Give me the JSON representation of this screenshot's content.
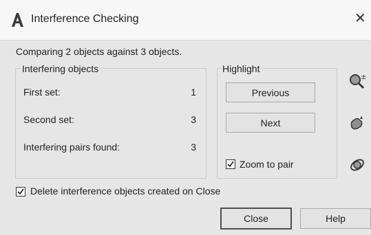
{
  "window": {
    "title": "Interference Checking",
    "close_symbol": "✕"
  },
  "summary": "Comparing 2 objects against 3 objects.",
  "interfering_objects": {
    "group_title": "Interfering objects",
    "rows": [
      {
        "label": "First set:",
        "value": "1"
      },
      {
        "label": "Second set:",
        "value": "3"
      },
      {
        "label": "Interfering pairs found:",
        "value": "3"
      }
    ]
  },
  "highlight": {
    "group_title": "Highlight",
    "previous_label": "Previous",
    "next_label": "Next",
    "zoom_to_pair_label": "Zoom to pair",
    "zoom_to_pair_checked": true
  },
  "side_icons": [
    "zoom-realtime-icon",
    "pan-icon",
    "orbit-icon"
  ],
  "delete_on_close": {
    "label": "Delete interference objects created on Close",
    "checked": true
  },
  "footer": {
    "close_label": "Close",
    "help_label": "Help"
  },
  "colors": {
    "dialog_bg": "#e6e6e6",
    "titlebar_bg": "#f7f7f7",
    "logo_red": "#d12c2c"
  }
}
